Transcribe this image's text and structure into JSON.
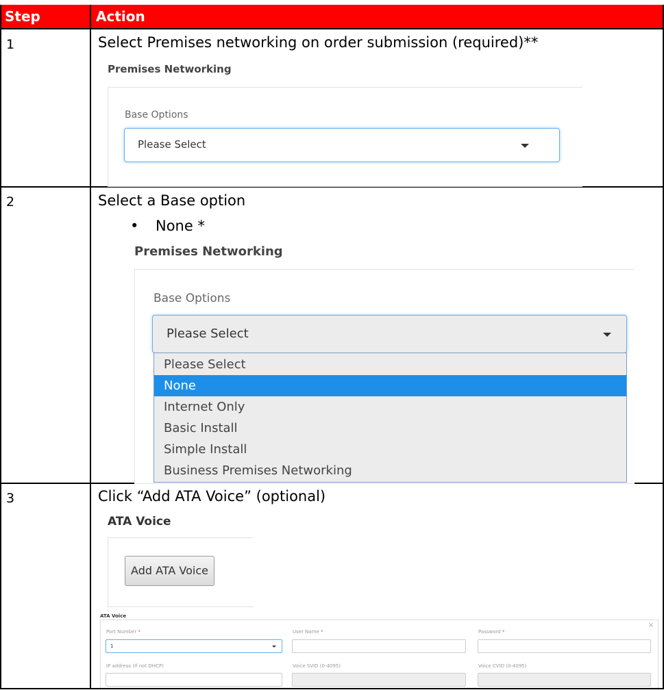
{
  "table": {
    "headers": {
      "step": "Step",
      "action": "Action"
    },
    "header_color": "#ff0000"
  },
  "rows": [
    {
      "step": "1",
      "action": "Select Premises networking on order submission (required)**",
      "screenshot": {
        "section_title": "Premises Networking",
        "field_label": "Base Options",
        "select_value": "Please Select"
      }
    },
    {
      "step": "2",
      "action": "Select a Base option",
      "bullet": "None *",
      "screenshot": {
        "section_title": "Premises Networking",
        "field_label": "Base Options",
        "select_value": "Please Select",
        "dropdown_options": [
          "Please Select",
          "None",
          "Internet Only",
          "Basic Install",
          "Simple Install",
          "Business Premises Networking"
        ],
        "highlighted_option": "None"
      }
    },
    {
      "step": "3",
      "action": "Click “Add ATA Voice” (optional)",
      "screenshot": {
        "section_title": "ATA Voice",
        "button_label": "Add ATA Voice",
        "form_title": "ATA Voice",
        "fields": {
          "port_number": {
            "label": "Port Number",
            "value": "1"
          },
          "user_name": {
            "label": "User Name"
          },
          "password": {
            "label": "Password"
          },
          "ip_address": {
            "label": "IP address (If not DHCP)"
          },
          "voice_svid": {
            "label": "Voice SVID (0-4095)"
          },
          "voice_cvid": {
            "label": "Voice CVID (0-4095)"
          }
        },
        "required_marker": "*",
        "close_icon": "close-icon"
      }
    }
  ],
  "colors": {
    "highlight": "#1e8fe8",
    "focus_border": "#66afe9",
    "required": "#d9534f"
  }
}
